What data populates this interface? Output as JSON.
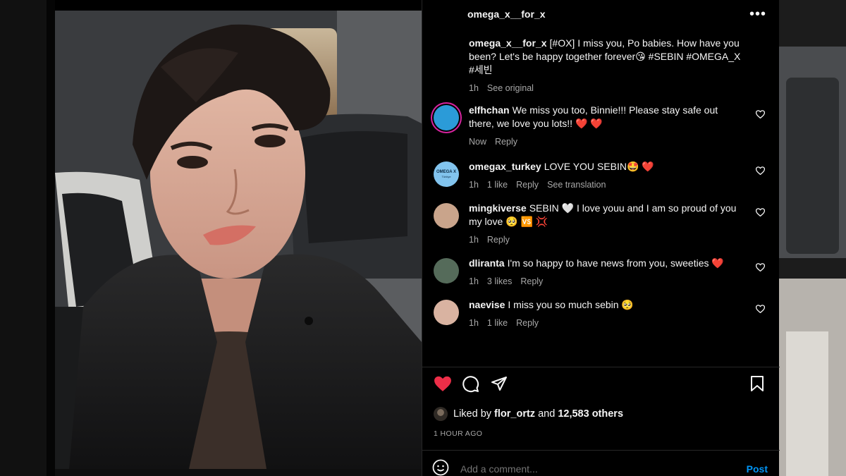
{
  "post": {
    "author": "omega_x__for_x",
    "caption_user": "omega_x__for_x",
    "caption_text": "[#OX] I miss you, Po babies. How have you been? Let's be happy together forever😘 #SEBIN #OMEGA_X #세빈",
    "caption_time": "1h",
    "caption_see_original": "See original"
  },
  "comments": [
    {
      "user": "elfhchan",
      "text": "We miss you too, Binnie!!! Please stay safe out there, we love you lots!! ❤️ ❤️",
      "time": "Now",
      "likes": "",
      "reply": "Reply",
      "translation": "",
      "avatar_color": "#2b9bd8",
      "avatar_icon": "avatar-elfhchan"
    },
    {
      "user": "omegax_turkey",
      "text": "LOVE YOU SEBIN🤩 ❤️",
      "time": "1h",
      "likes": "1 like",
      "reply": "Reply",
      "translation": "See translation",
      "avatar_color": "#82c4ee",
      "avatar_icon": "avatar-omegax-turkey",
      "avatar_text_top": "OMEGA X",
      "avatar_text_bottom": "Türkiye"
    },
    {
      "user": "mingkiverse",
      "text": "SEBIN 🤍 I love youu and I am so proud of you my love 🥺 🆚 💢",
      "time": "1h",
      "likes": "",
      "reply": "Reply",
      "translation": "",
      "avatar_color": "#c9a48b",
      "avatar_icon": "avatar-mingkiverse"
    },
    {
      "user": "dliranta",
      "text": "I'm so happy to have news from you, sweeties ❤️",
      "time": "1h",
      "likes": "3 likes",
      "reply": "Reply",
      "translation": "",
      "avatar_color": "#556b5a",
      "avatar_icon": "avatar-dliranta"
    },
    {
      "user": "naevise",
      "text": "I miss you so much sebin 🥺",
      "time": "1h",
      "likes": "1 like",
      "reply": "Reply",
      "translation": "",
      "avatar_color": "#d9b3a1",
      "avatar_icon": "avatar-naevise"
    }
  ],
  "actions": {
    "liked": true,
    "like_icon": "heart-filled-icon",
    "comment_icon": "comment-icon",
    "share_icon": "share-icon",
    "save_icon": "bookmark-icon"
  },
  "likes": {
    "prefix": "Liked by",
    "user": "flor_ortz",
    "joiner": "and",
    "others": "12,583 others"
  },
  "time_ago": "1 HOUR AGO",
  "comment_input": {
    "placeholder": "Add a comment...",
    "post_label": "Post",
    "emoji_icon": "smiley-icon"
  },
  "colors": {
    "accent": "#0095f6",
    "like": "#ed2e48",
    "panel_bg": "#000000"
  }
}
